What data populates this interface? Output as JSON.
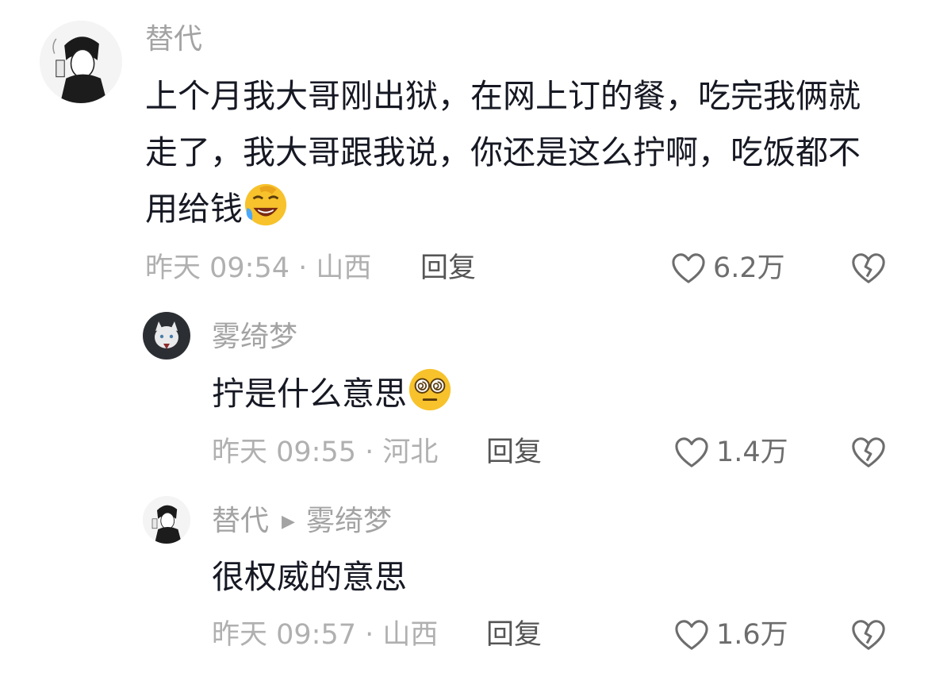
{
  "comments": [
    {
      "author": "替代",
      "text": "上个月我大哥刚出狱，在网上订的餐，吃完我俩就走了，我大哥跟我说，你还是这么拧啊，吃饭都不用给钱",
      "emoji_icon": "laughing-tears-emoji",
      "time": "昨天 09:54 · 山西",
      "reply_label": "回复",
      "likes": "6.2万"
    },
    {
      "author": "雾绮梦",
      "text": "拧是什么意思",
      "emoji_icon": "dizzy-face-emoji",
      "time": "昨天 09:55 · 河北",
      "reply_label": "回复",
      "likes": "1.4万"
    },
    {
      "author": "替代",
      "reply_to": "雾绮梦",
      "text": "很权威的意思",
      "time": "昨天 09:57 · 山西",
      "reply_label": "回复",
      "likes": "1.6万"
    }
  ],
  "icons": {
    "like": "heart-outline-icon",
    "dislike": "broken-heart-icon",
    "reply_arrow": "play-triangle-icon"
  },
  "colors": {
    "text_primary": "#161823",
    "text_muted": "#a3a3a3",
    "emoji_yellow": "#f7c22b"
  }
}
